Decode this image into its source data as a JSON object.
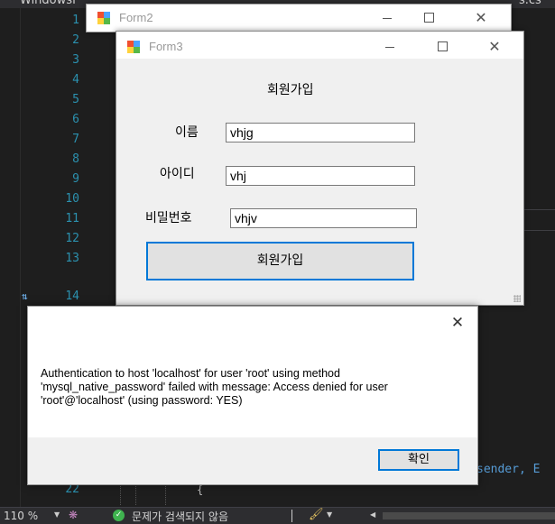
{
  "vs": {
    "title_fragment_left": "Windowsf",
    "title_fragment_right": "s.cs",
    "line_numbers": [
      "1",
      "2",
      "3",
      "4",
      "5",
      "6",
      "7",
      "8",
      "9",
      "10",
      "11",
      "12",
      "13",
      "14",
      "22"
    ],
    "code_right": "sender, E",
    "code_line22": "{",
    "statusbar": {
      "zoom": "110 %",
      "issues": "문제가 검색되지 않음"
    }
  },
  "form2": {
    "title": "Form2"
  },
  "form3": {
    "title": "Form3",
    "heading": "회원가입",
    "name_label": "이름",
    "name_value": "vhjg",
    "id_label": "아이디",
    "id_value": "vhj",
    "pw_label": "비밀번호",
    "pw_value": "vhjv",
    "signup_button": "회원가입"
  },
  "messagebox": {
    "message": "Authentication to host 'localhost' for user 'root' using method 'mysql_native_password' failed with message: Access denied for user 'root'@'localhost' (using password: YES)",
    "ok_button": "확인"
  }
}
